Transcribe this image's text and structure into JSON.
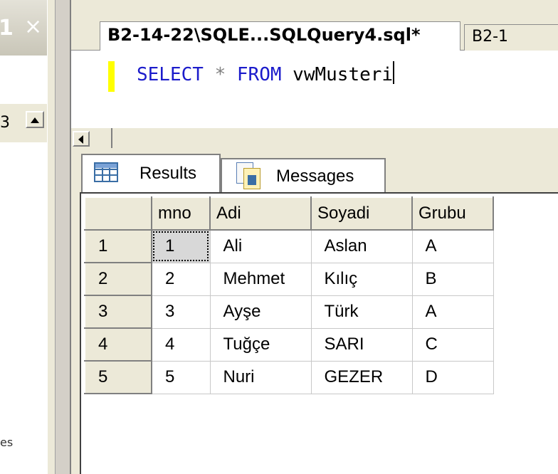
{
  "left_panel": {
    "title_number": "1",
    "close_glyph": "×",
    "toolbar_number": "3",
    "bottom_text": "es",
    "icons": [
      "close-icon",
      "scroll-up-icon"
    ]
  },
  "editor": {
    "active_tab": "B2-14-22\\SQLE...SQLQuery4.sql*",
    "inactive_tab": "B2-1",
    "sql": {
      "select_kw": "SELECT",
      "star": "*",
      "from_kw": "FROM",
      "object": "vwMusteri"
    },
    "keyword_color": "#1b1bcb"
  },
  "results_pane": {
    "tabs": [
      {
        "label": "Results",
        "icon": "grid-icon"
      },
      {
        "label": "Messages",
        "icon": "messages-icon"
      }
    ],
    "columns": [
      "mno",
      "Adi",
      "Soyadi",
      "Grubu"
    ],
    "rows": [
      {
        "num": "1",
        "mno": "1",
        "adi": "Ali",
        "soyadi": "Aslan",
        "grubu": "A"
      },
      {
        "num": "2",
        "mno": "2",
        "adi": "Mehmet",
        "soyadi": "Kılıç",
        "grubu": "B"
      },
      {
        "num": "3",
        "mno": "3",
        "adi": "Ayşe",
        "soyadi": "Türk",
        "grubu": "A"
      },
      {
        "num": "4",
        "mno": "4",
        "adi": "Tuğçe",
        "soyadi": "SARI",
        "grubu": "C"
      },
      {
        "num": "5",
        "mno": "5",
        "adi": "Nuri",
        "soyadi": "GEZER",
        "grubu": "D"
      }
    ],
    "selected_cell": "row 1, mno"
  }
}
